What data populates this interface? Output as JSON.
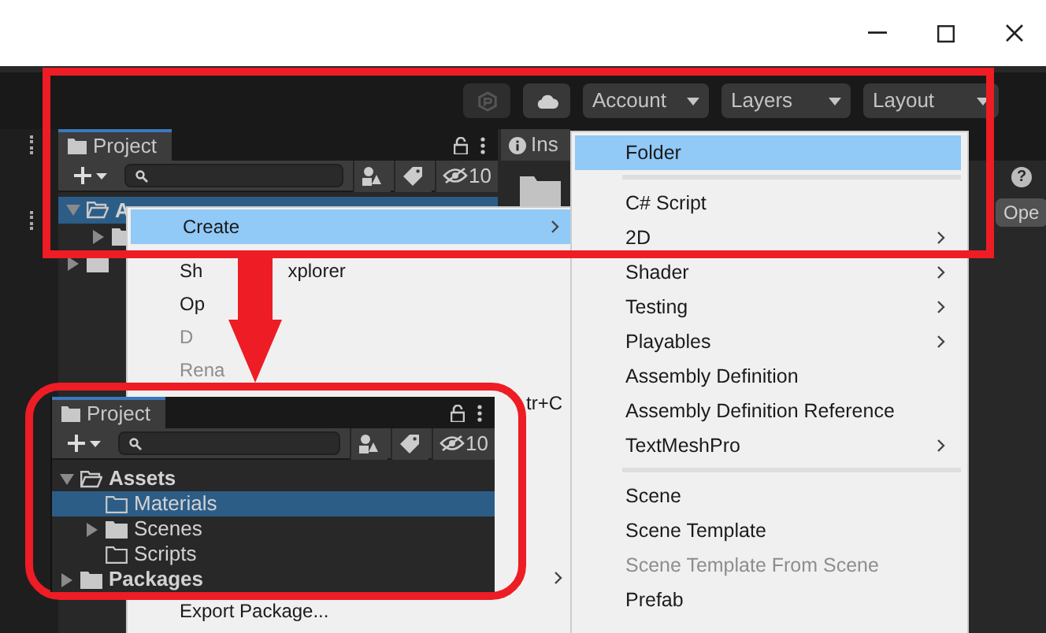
{
  "toolbar": {
    "dropdowns": [
      {
        "label": "Account"
      },
      {
        "label": "Layers"
      },
      {
        "label": "Layout"
      }
    ]
  },
  "project_panel": {
    "tab": "Project",
    "hidden_count": "10",
    "tree": [
      {
        "label": "A",
        "expanded": true,
        "selected": true,
        "children": [
          {
            "expanded": false,
            "selected": false
          }
        ]
      },
      {
        "expanded": false,
        "selected": false
      }
    ]
  },
  "inspector": {
    "tab": "Ins",
    "button": "Ope",
    "help": "?"
  },
  "context_menu": {
    "items": [
      {
        "label": "Create",
        "selected": true,
        "disabled": false,
        "submenu": true
      },
      {
        "label": "Sh",
        "label_end": "xplorer",
        "selected": false,
        "disabled": false
      },
      {
        "label": "Op",
        "selected": false,
        "disabled": false
      },
      {
        "label": "D",
        "selected": false,
        "disabled": true
      },
      {
        "label": "Rena",
        "selected": false,
        "disabled": true
      },
      {
        "shortcut": "tr+C",
        "selected": false,
        "disabled": false
      }
    ],
    "lower_items": [
      {
        "selected": false,
        "disabled": false,
        "submenu": true
      },
      {
        "label": "Export Package...",
        "selected": false,
        "disabled": false
      }
    ]
  },
  "create_submenu": {
    "items": [
      {
        "kind": "item",
        "label": "Folder",
        "selected": true,
        "disabled": false,
        "submenu": false
      },
      {
        "kind": "separator"
      },
      {
        "kind": "item",
        "label": "C# Script",
        "selected": false,
        "disabled": false,
        "submenu": false
      },
      {
        "kind": "item",
        "label": "2D",
        "selected": false,
        "disabled": false,
        "submenu": true
      },
      {
        "kind": "item",
        "label": "Shader",
        "selected": false,
        "disabled": false,
        "submenu": true
      },
      {
        "kind": "item",
        "label": "Testing",
        "selected": false,
        "disabled": false,
        "submenu": true
      },
      {
        "kind": "item",
        "label": "Playables",
        "selected": false,
        "disabled": false,
        "submenu": true
      },
      {
        "kind": "item",
        "label": "Assembly Definition",
        "selected": false,
        "disabled": false,
        "submenu": false
      },
      {
        "kind": "item",
        "label": "Assembly Definition Reference",
        "selected": false,
        "disabled": false,
        "submenu": false
      },
      {
        "kind": "item",
        "label": "TextMeshPro",
        "selected": false,
        "disabled": false,
        "submenu": true
      },
      {
        "kind": "separator"
      },
      {
        "kind": "item",
        "label": "Scene",
        "selected": false,
        "disabled": false,
        "submenu": false
      },
      {
        "kind": "item",
        "label": "Scene Template",
        "selected": false,
        "disabled": false,
        "submenu": false
      },
      {
        "kind": "item",
        "label": "Scene Template From Scene",
        "selected": false,
        "disabled": true,
        "submenu": false
      },
      {
        "kind": "item",
        "label": "Prefab",
        "selected": false,
        "disabled": false,
        "submenu": false
      }
    ]
  },
  "callout": {
    "tab": "Project",
    "hidden_count": "10",
    "tree": [
      {
        "label": "Assets",
        "expanded": true,
        "expandable": true,
        "selected": false,
        "children": [
          {
            "label": "Materials",
            "expandable": false,
            "expanded": false,
            "selected": true
          },
          {
            "label": "Scenes",
            "expandable": true,
            "expanded": false,
            "selected": false
          },
          {
            "label": "Scripts",
            "expandable": false,
            "expanded": false,
            "selected": false
          }
        ]
      },
      {
        "label": "Packages",
        "expandable": true,
        "expanded": false,
        "selected": false
      }
    ]
  }
}
